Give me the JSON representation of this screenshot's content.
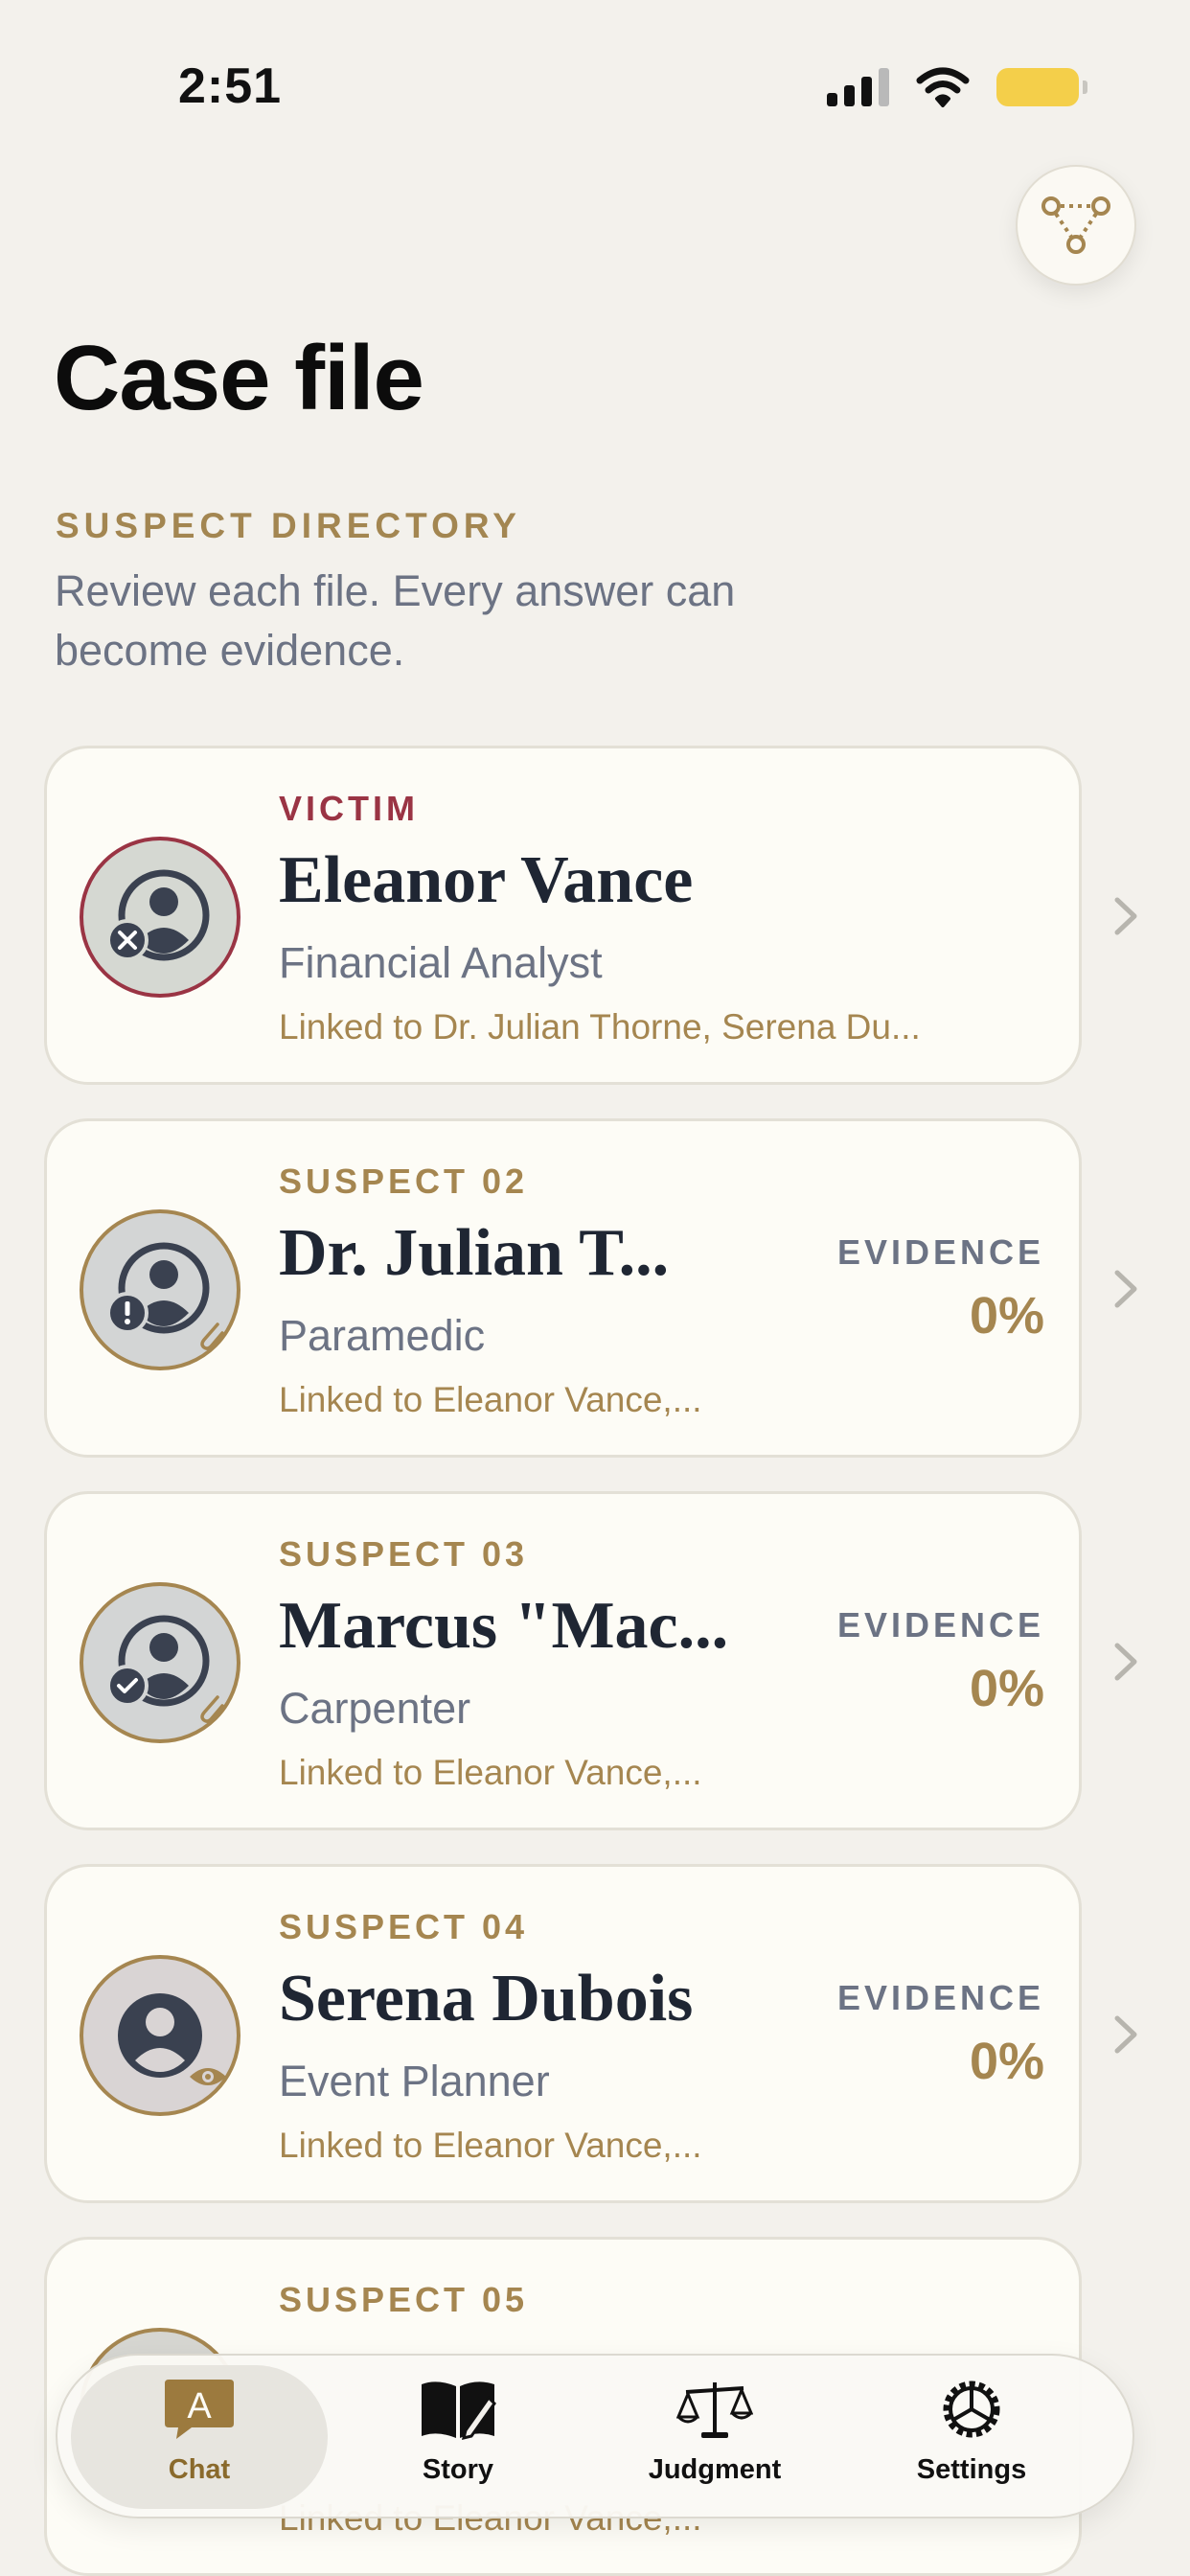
{
  "status_bar": {
    "time": "2:51"
  },
  "header": {
    "title": "Case file",
    "section_label": "SUSPECT DIRECTORY",
    "section_desc": "Review each file. Every answer can become evidence."
  },
  "cards": [
    {
      "role": "VICTIM",
      "name": "Eleanor Vance",
      "occupation": "Financial Analyst",
      "links": "Linked to Dr. Julian Thorne, Serena Du...",
      "avatar_badge": "x-circle-icon"
    },
    {
      "role": "SUSPECT 02",
      "name": "Dr. Julian T...",
      "occupation": "Paramedic",
      "links": "Linked to Eleanor Vance,...",
      "evidence_label": "EVIDENCE",
      "evidence_value": "0%",
      "avatar_badge": "exclamation-circle-icon"
    },
    {
      "role": "SUSPECT 03",
      "name": "Marcus \"Mac...",
      "occupation": "Carpenter",
      "links": "Linked to Eleanor Vance,...",
      "evidence_label": "EVIDENCE",
      "evidence_value": "0%",
      "avatar_badge": "check-circle-icon"
    },
    {
      "role": "SUSPECT 04",
      "name": "Serena Dubois",
      "occupation": "Event Planner",
      "links": "Linked to Eleanor Vance,...",
      "evidence_label": "EVIDENCE",
      "evidence_value": "0%",
      "avatar_badge": "eye-icon"
    },
    {
      "role": "SUSPECT 05",
      "name": "",
      "occupation": "",
      "links": "Linked to Eleanor Vance,...",
      "evidence_label": "",
      "evidence_value": ""
    }
  ],
  "tabs": [
    {
      "label": "Chat",
      "icon": "chat-bubble-a-icon",
      "active": true
    },
    {
      "label": "Story",
      "icon": "book-pen-icon",
      "active": false
    },
    {
      "label": "Judgment",
      "icon": "scales-icon",
      "active": false
    },
    {
      "label": "Settings",
      "icon": "gear-icon",
      "active": false
    }
  ],
  "colors": {
    "background": "#f3f1ec",
    "card": "#fdfcf6",
    "gold": "#a58650",
    "victim_red": "#9a3444",
    "slate": "#6c7384",
    "navy": "#1f2633"
  }
}
